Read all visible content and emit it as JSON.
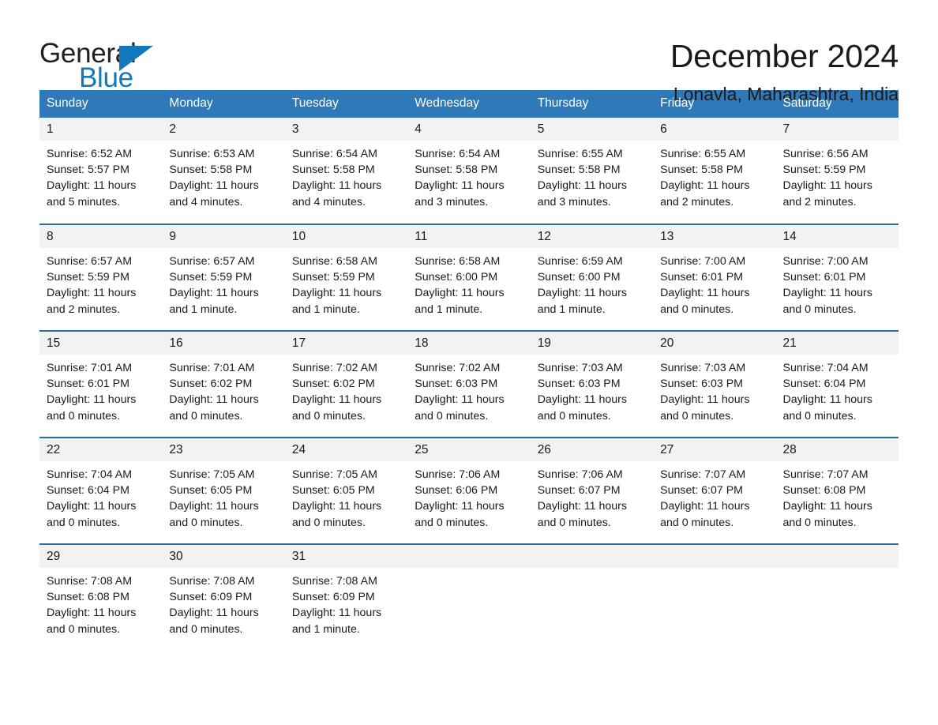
{
  "brand": {
    "name_part1": "General",
    "name_part2": "Blue",
    "accent_color": "#1277bc"
  },
  "header": {
    "title": "December 2024",
    "location": "Lonavla, Maharashtra, India",
    "header_bg": "#3079b9",
    "row_divider_color": "#2d6ea8",
    "daynum_bg": "#f2f2f2"
  },
  "weekdays": [
    "Sunday",
    "Monday",
    "Tuesday",
    "Wednesday",
    "Thursday",
    "Friday",
    "Saturday"
  ],
  "weeks": [
    [
      {
        "day": "1",
        "sunrise": "Sunrise: 6:52 AM",
        "sunset": "Sunset: 5:57 PM",
        "daylight": "Daylight: 11 hours and 5 minutes."
      },
      {
        "day": "2",
        "sunrise": "Sunrise: 6:53 AM",
        "sunset": "Sunset: 5:58 PM",
        "daylight": "Daylight: 11 hours and 4 minutes."
      },
      {
        "day": "3",
        "sunrise": "Sunrise: 6:54 AM",
        "sunset": "Sunset: 5:58 PM",
        "daylight": "Daylight: 11 hours and 4 minutes."
      },
      {
        "day": "4",
        "sunrise": "Sunrise: 6:54 AM",
        "sunset": "Sunset: 5:58 PM",
        "daylight": "Daylight: 11 hours and 3 minutes."
      },
      {
        "day": "5",
        "sunrise": "Sunrise: 6:55 AM",
        "sunset": "Sunset: 5:58 PM",
        "daylight": "Daylight: 11 hours and 3 minutes."
      },
      {
        "day": "6",
        "sunrise": "Sunrise: 6:55 AM",
        "sunset": "Sunset: 5:58 PM",
        "daylight": "Daylight: 11 hours and 2 minutes."
      },
      {
        "day": "7",
        "sunrise": "Sunrise: 6:56 AM",
        "sunset": "Sunset: 5:59 PM",
        "daylight": "Daylight: 11 hours and 2 minutes."
      }
    ],
    [
      {
        "day": "8",
        "sunrise": "Sunrise: 6:57 AM",
        "sunset": "Sunset: 5:59 PM",
        "daylight": "Daylight: 11 hours and 2 minutes."
      },
      {
        "day": "9",
        "sunrise": "Sunrise: 6:57 AM",
        "sunset": "Sunset: 5:59 PM",
        "daylight": "Daylight: 11 hours and 1 minute."
      },
      {
        "day": "10",
        "sunrise": "Sunrise: 6:58 AM",
        "sunset": "Sunset: 5:59 PM",
        "daylight": "Daylight: 11 hours and 1 minute."
      },
      {
        "day": "11",
        "sunrise": "Sunrise: 6:58 AM",
        "sunset": "Sunset: 6:00 PM",
        "daylight": "Daylight: 11 hours and 1 minute."
      },
      {
        "day": "12",
        "sunrise": "Sunrise: 6:59 AM",
        "sunset": "Sunset: 6:00 PM",
        "daylight": "Daylight: 11 hours and 1 minute."
      },
      {
        "day": "13",
        "sunrise": "Sunrise: 7:00 AM",
        "sunset": "Sunset: 6:01 PM",
        "daylight": "Daylight: 11 hours and 0 minutes."
      },
      {
        "day": "14",
        "sunrise": "Sunrise: 7:00 AM",
        "sunset": "Sunset: 6:01 PM",
        "daylight": "Daylight: 11 hours and 0 minutes."
      }
    ],
    [
      {
        "day": "15",
        "sunrise": "Sunrise: 7:01 AM",
        "sunset": "Sunset: 6:01 PM",
        "daylight": "Daylight: 11 hours and 0 minutes."
      },
      {
        "day": "16",
        "sunrise": "Sunrise: 7:01 AM",
        "sunset": "Sunset: 6:02 PM",
        "daylight": "Daylight: 11 hours and 0 minutes."
      },
      {
        "day": "17",
        "sunrise": "Sunrise: 7:02 AM",
        "sunset": "Sunset: 6:02 PM",
        "daylight": "Daylight: 11 hours and 0 minutes."
      },
      {
        "day": "18",
        "sunrise": "Sunrise: 7:02 AM",
        "sunset": "Sunset: 6:03 PM",
        "daylight": "Daylight: 11 hours and 0 minutes."
      },
      {
        "day": "19",
        "sunrise": "Sunrise: 7:03 AM",
        "sunset": "Sunset: 6:03 PM",
        "daylight": "Daylight: 11 hours and 0 minutes."
      },
      {
        "day": "20",
        "sunrise": "Sunrise: 7:03 AM",
        "sunset": "Sunset: 6:03 PM",
        "daylight": "Daylight: 11 hours and 0 minutes."
      },
      {
        "day": "21",
        "sunrise": "Sunrise: 7:04 AM",
        "sunset": "Sunset: 6:04 PM",
        "daylight": "Daylight: 11 hours and 0 minutes."
      }
    ],
    [
      {
        "day": "22",
        "sunrise": "Sunrise: 7:04 AM",
        "sunset": "Sunset: 6:04 PM",
        "daylight": "Daylight: 11 hours and 0 minutes."
      },
      {
        "day": "23",
        "sunrise": "Sunrise: 7:05 AM",
        "sunset": "Sunset: 6:05 PM",
        "daylight": "Daylight: 11 hours and 0 minutes."
      },
      {
        "day": "24",
        "sunrise": "Sunrise: 7:05 AM",
        "sunset": "Sunset: 6:05 PM",
        "daylight": "Daylight: 11 hours and 0 minutes."
      },
      {
        "day": "25",
        "sunrise": "Sunrise: 7:06 AM",
        "sunset": "Sunset: 6:06 PM",
        "daylight": "Daylight: 11 hours and 0 minutes."
      },
      {
        "day": "26",
        "sunrise": "Sunrise: 7:06 AM",
        "sunset": "Sunset: 6:07 PM",
        "daylight": "Daylight: 11 hours and 0 minutes."
      },
      {
        "day": "27",
        "sunrise": "Sunrise: 7:07 AM",
        "sunset": "Sunset: 6:07 PM",
        "daylight": "Daylight: 11 hours and 0 minutes."
      },
      {
        "day": "28",
        "sunrise": "Sunrise: 7:07 AM",
        "sunset": "Sunset: 6:08 PM",
        "daylight": "Daylight: 11 hours and 0 minutes."
      }
    ],
    [
      {
        "day": "29",
        "sunrise": "Sunrise: 7:08 AM",
        "sunset": "Sunset: 6:08 PM",
        "daylight": "Daylight: 11 hours and 0 minutes."
      },
      {
        "day": "30",
        "sunrise": "Sunrise: 7:08 AM",
        "sunset": "Sunset: 6:09 PM",
        "daylight": "Daylight: 11 hours and 0 minutes."
      },
      {
        "day": "31",
        "sunrise": "Sunrise: 7:08 AM",
        "sunset": "Sunset: 6:09 PM",
        "daylight": "Daylight: 11 hours and 1 minute."
      },
      {
        "day": "",
        "sunrise": "",
        "sunset": "",
        "daylight": ""
      },
      {
        "day": "",
        "sunrise": "",
        "sunset": "",
        "daylight": ""
      },
      {
        "day": "",
        "sunrise": "",
        "sunset": "",
        "daylight": ""
      },
      {
        "day": "",
        "sunrise": "",
        "sunset": "",
        "daylight": ""
      }
    ]
  ]
}
